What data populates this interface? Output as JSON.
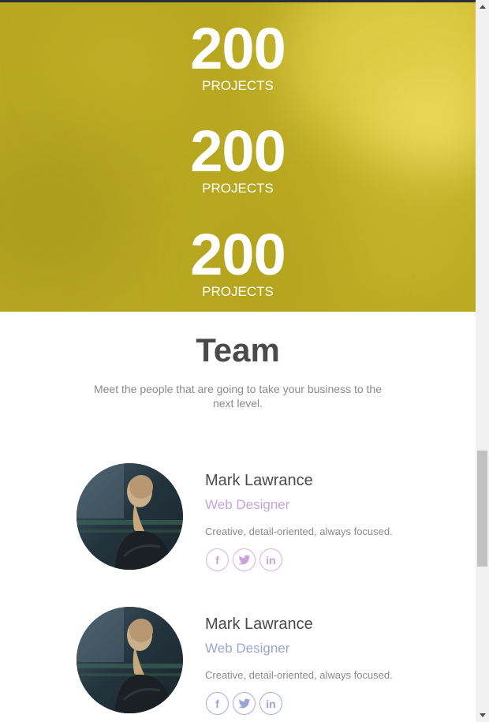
{
  "counters": [
    {
      "value": "200",
      "label": "PROJECTS"
    },
    {
      "value": "200",
      "label": "PROJECTS"
    },
    {
      "value": "200",
      "label": "PROJECTS"
    }
  ],
  "colors": {
    "stats_bg": "#b8a821",
    "heading": "#4a4a4a",
    "muted": "#8a8a8a",
    "role_purple": "#c9a3d8",
    "role_blue": "#9aa4d4"
  },
  "team": {
    "title": "Team",
    "subtitle": "Meet the people that are going to take your business to the next level.",
    "members": [
      {
        "name": "Mark Lawrance",
        "role": "Web Designer",
        "description": "Creative, detail-oriented, always focused.",
        "socials": [
          {
            "icon": "facebook-icon",
            "glyph": "f"
          },
          {
            "icon": "twitter-icon",
            "glyph": "🐦"
          },
          {
            "icon": "linkedin-icon",
            "glyph": "in"
          }
        ]
      },
      {
        "name": "Mark Lawrance",
        "role": "Web Designer",
        "description": "Creative, detail-oriented, always focused.",
        "socials": [
          {
            "icon": "facebook-icon",
            "glyph": "f"
          },
          {
            "icon": "twitter-icon",
            "glyph": "🐦"
          },
          {
            "icon": "linkedin-icon",
            "glyph": "in"
          }
        ]
      }
    ]
  }
}
